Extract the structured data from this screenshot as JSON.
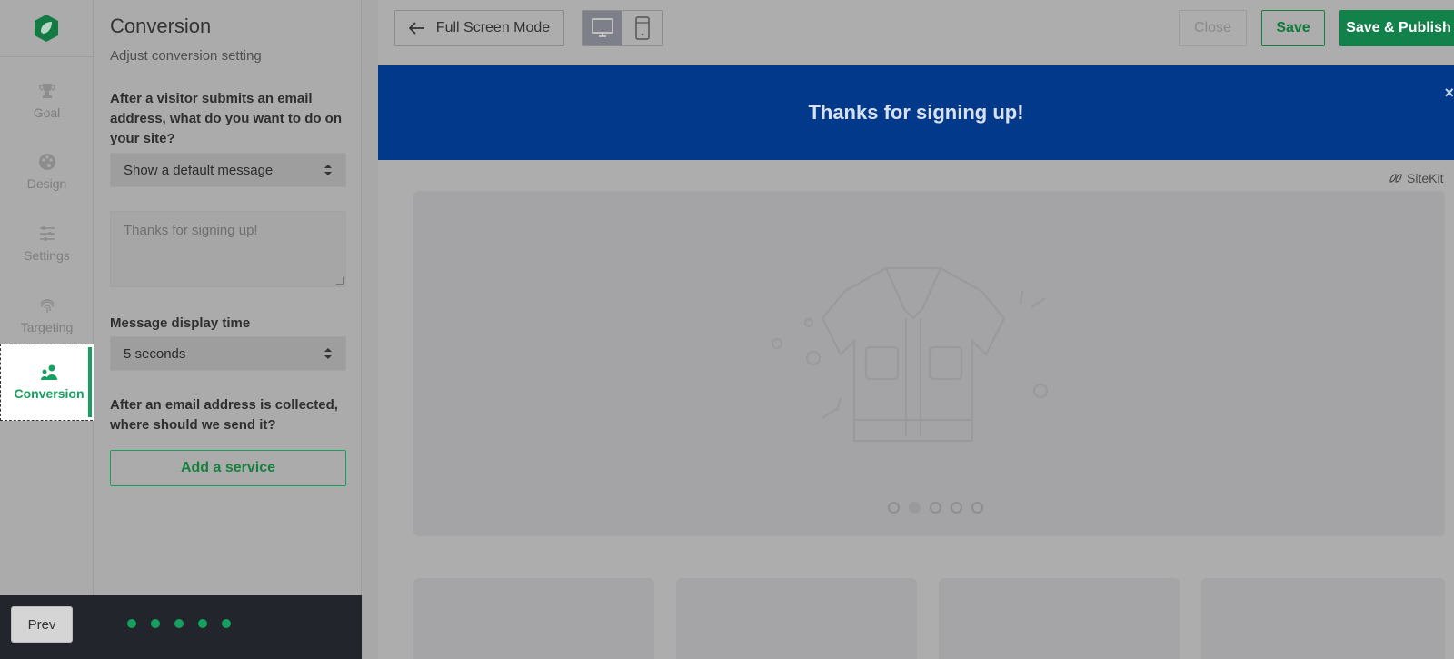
{
  "rail": {
    "items": [
      {
        "label": "Goal",
        "icon": "trophy-icon"
      },
      {
        "label": "Design",
        "icon": "palette-icon"
      },
      {
        "label": "Settings",
        "icon": "sliders-icon"
      },
      {
        "label": "Targeting",
        "icon": "fingerprint-icon"
      },
      {
        "label": "Conversion",
        "icon": "users-icon",
        "active": true
      }
    ]
  },
  "panel": {
    "title": "Conversion",
    "subtitle": "Adjust conversion setting",
    "question1": "After a visitor submits an email address, what do you want to do on your site?",
    "action_select": "Show a default message",
    "message_placeholder": "Thanks for signing up!",
    "display_time_label": "Message display time",
    "display_time_select": "5 seconds",
    "question2": "After an email address is collected, where should we send it?",
    "add_service_label": "Add a service"
  },
  "footer": {
    "prev_label": "Prev",
    "step_count": 5
  },
  "toolbar": {
    "fullscreen_label": "Full Screen Mode",
    "close_label": "Close",
    "save_label": "Save",
    "publish_label": "Save & Publish"
  },
  "preview": {
    "banner_text": "Thanks for signing up!",
    "banner_close": "×",
    "brand": "SiteKit",
    "carousel_count": 5,
    "carousel_current": 2
  },
  "colors": {
    "accent": "#16a05f",
    "banner": "#03398a",
    "footer": "#22262c"
  }
}
